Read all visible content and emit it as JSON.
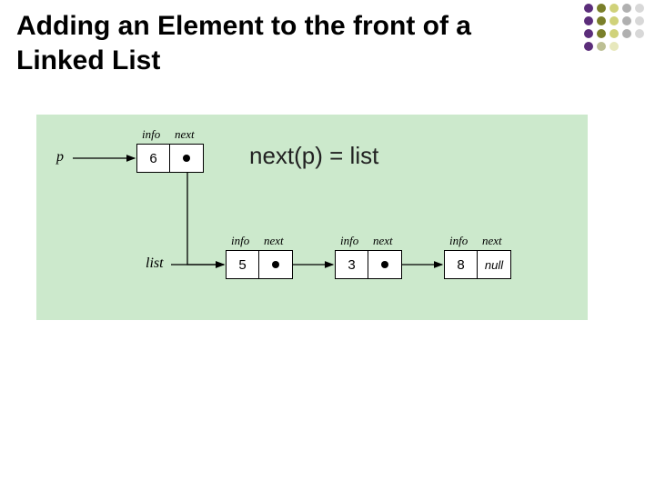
{
  "title": "Adding an Element to the front of a Linked List",
  "formula": "next(p) = list",
  "pointers": {
    "p": "p",
    "list": "list"
  },
  "field_labels": {
    "info": "info",
    "next": "next"
  },
  "null_label": "null",
  "nodes": {
    "p_node": {
      "info": "6",
      "next": "→ list (node 5)"
    },
    "list_head": {
      "info": "5",
      "next": "→ node 3"
    },
    "n2": {
      "info": "3",
      "next": "→ node 8"
    },
    "n3": {
      "info": "8",
      "next": "null"
    }
  },
  "deco_colors": {
    "c1": "#5b2d7a",
    "c2": "#7a7f2a",
    "c3": "#d0d27a",
    "c4": "#b0b0b0",
    "c5": "#d8d8d8"
  },
  "chart_data": {
    "type": "diagram",
    "description": "Linked list insertion at front. Pointer p references a new node with info=6 whose next has just been set to the old list head (info=5). Variable list still points to node 5. Chain: 5 → 3 → 8 → null.",
    "variables": {
      "p": {
        "points_to": "node6"
      },
      "list": {
        "points_to": "node5"
      }
    },
    "linked_list_nodes": [
      {
        "id": "node6",
        "info": 6,
        "next": "node5"
      },
      {
        "id": "node5",
        "info": 5,
        "next": "node3"
      },
      {
        "id": "node3",
        "info": 3,
        "next": "node8"
      },
      {
        "id": "node8",
        "info": 8,
        "next": null
      }
    ],
    "operation": "next(p) = list"
  }
}
